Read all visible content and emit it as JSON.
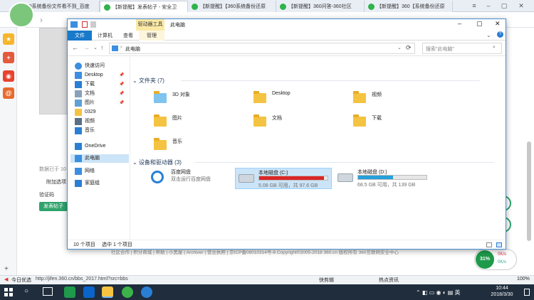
{
  "browser": {
    "tabs": [
      {
        "label": "360系统备份文件看不到_百度",
        "color": "#3d7ee0"
      },
      {
        "label": "【新提醒】发表帖子 - 安全卫",
        "color": "#2fb34a",
        "active": true
      },
      {
        "label": "【新提醒】【360系统备份还原",
        "color": "#2fb34a"
      },
      {
        "label": "【新提醒】360问答-360社区",
        "color": "#2fb34a"
      },
      {
        "label": "【新提醒】360【系统备份还原",
        "color": "#2fb34a"
      }
    ],
    "page_bits": {
      "data_source": "数据已于 10",
      "attach": "附加选项",
      "captcha": "验证码",
      "submit": "发表帖子",
      "footer": "社区合作 | 积分商城 | 帮助 | 小黑屋 | Archiver | 营业执照 | 京ICP备08010314号-6 Copyright©2005-2018 360.cn 版权所有 360互联网安全中心"
    },
    "status_left": "今日优选",
    "status_url": "http://jifen.360.cn/bbs_2017.html?src=bbs",
    "status_right": [
      "快剪辑",
      "热点资讯",
      "100%"
    ],
    "float_widget": {
      "pct": "31%",
      "up": "0K/s",
      "down": "0K/s"
    }
  },
  "explorer": {
    "title": "此电脑",
    "drive_tools": "驱动器工具",
    "ribbon_tabs": [
      "文件",
      "计算机",
      "查看",
      "管理"
    ],
    "address": "此电脑",
    "search_placeholder": "搜索\"此电脑\"",
    "nav": [
      {
        "label": "快速访问",
        "icon": "star-icon",
        "icon_color": "#3b8ee0"
      },
      {
        "label": "Desktop",
        "icon": "desktop-icon",
        "icon_color": "#3b8ee0",
        "pin": true
      },
      {
        "label": "下载",
        "icon": "download-icon",
        "icon_color": "#2a7fd4",
        "pin": true
      },
      {
        "label": "文档",
        "icon": "document-icon",
        "icon_color": "#8aa0b8",
        "pin": true
      },
      {
        "label": "图片",
        "icon": "picture-icon",
        "icon_color": "#5fa0d8",
        "pin": true
      },
      {
        "label": "0329",
        "icon": "folder-icon",
        "icon_color": "#f5c342"
      },
      {
        "label": "视频",
        "icon": "video-icon",
        "icon_color": "#5a6e86"
      },
      {
        "label": "音乐",
        "icon": "music-icon",
        "icon_color": "#2a7fd4"
      },
      {
        "label": "OneDrive",
        "icon": "cloud-icon",
        "icon_color": "#2a7fd4"
      },
      {
        "label": "此电脑",
        "icon": "computer-icon",
        "icon_color": "#3b8ee0",
        "selected": true
      },
      {
        "label": "网络",
        "icon": "network-icon",
        "icon_color": "#3b8ee0"
      },
      {
        "label": "家庭组",
        "icon": "homegroup-icon",
        "icon_color": "#2a7fd4"
      }
    ],
    "folders_header": "文件夹 (7)",
    "folders": [
      "3D 对象",
      "Desktop",
      "视频",
      "图片",
      "文档",
      "下载",
      "音乐"
    ],
    "devices_header": "设备和驱动器 (3)",
    "devices": [
      {
        "name": "百度网盘",
        "sub": "双击运行百度网盘",
        "type": "app"
      },
      {
        "name": "本地磁盘 (C:)",
        "sub": "5.08 GB 可用，共 97.6 GB",
        "used_fraction": 0.948,
        "bar_color": "#da2626",
        "selected": true
      },
      {
        "name": "本地磁盘 (D:)",
        "sub": "68.5 GB 可用，共 139 GB",
        "used_fraction": 0.507,
        "bar_color": "#26a0da"
      }
    ],
    "status_count": "10 个项目",
    "status_selected": "选中 1 个项目"
  },
  "taskbar": {
    "time": "10:44",
    "date": "2018/3/30"
  }
}
